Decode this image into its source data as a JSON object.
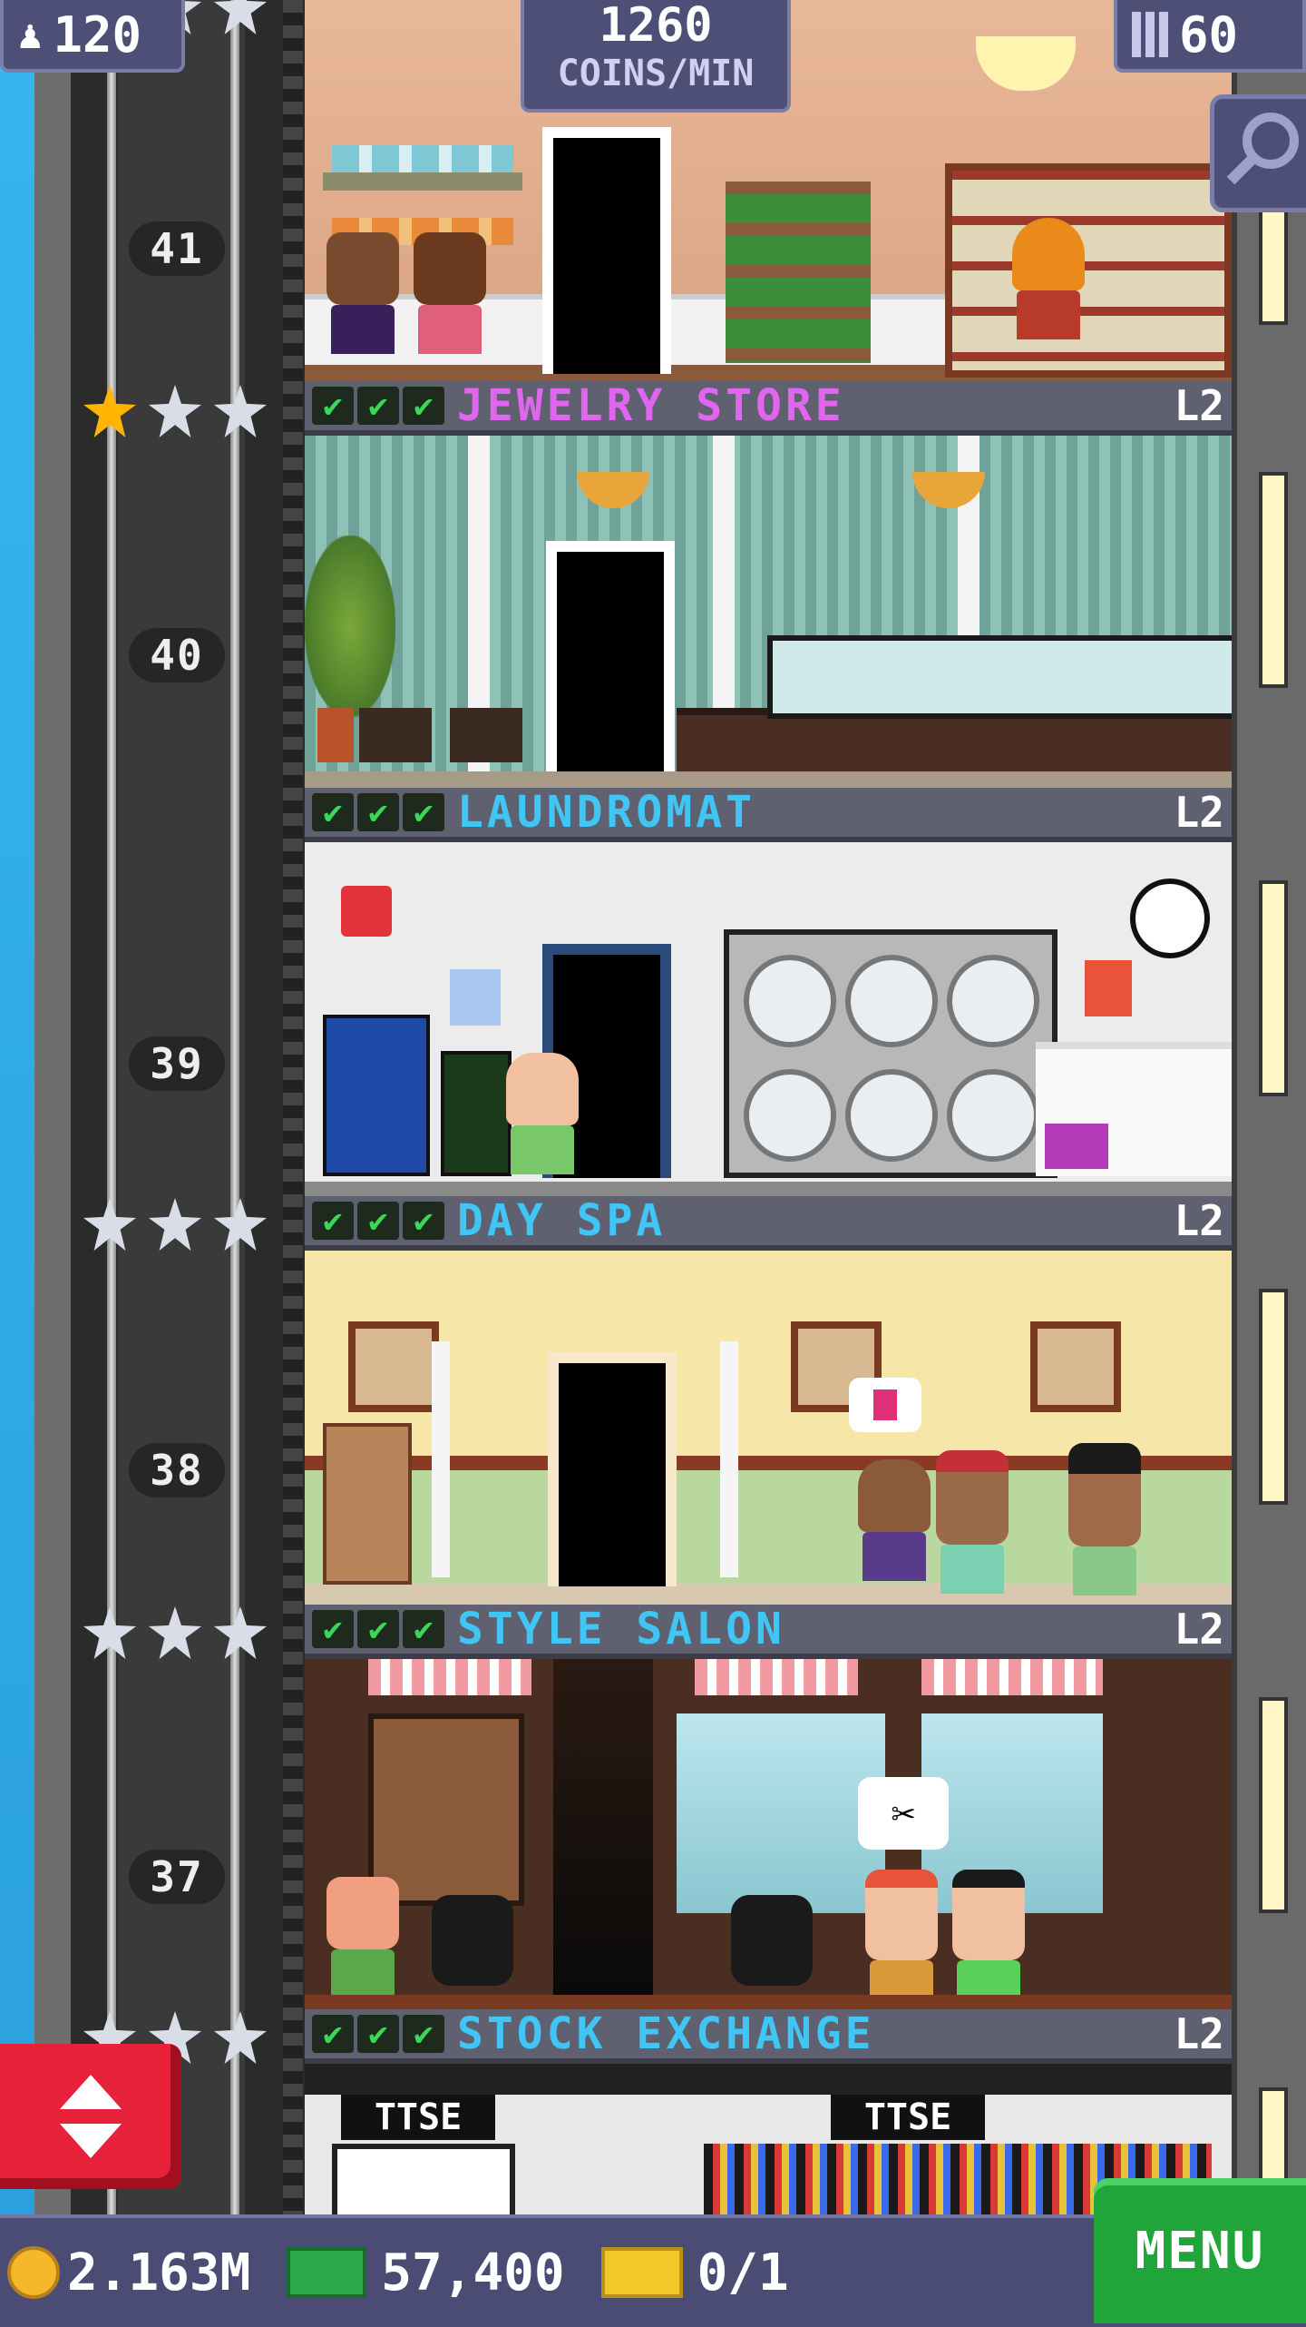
{
  "hud": {
    "population": "120",
    "coins_per_min_value": "1260",
    "coins_per_min_label": "COINS/MIN",
    "floors": "60"
  },
  "floors": [
    {
      "number": "41",
      "name": "JEWELRY STORE",
      "level": "L2",
      "name_color": "#e066f0"
    },
    {
      "number": "40",
      "name": "LAUNDROMAT",
      "level": "L2",
      "name_color": "#3fc6f5"
    },
    {
      "number": "39",
      "name": "DAY SPA",
      "level": "L2",
      "name_color": "#3fc6f5"
    },
    {
      "number": "38",
      "name": "STYLE SALON",
      "level": "L2",
      "name_color": "#3fc6f5"
    },
    {
      "number": "37",
      "name": "STOCK EXCHANGE",
      "level": "L2",
      "name_color": "#3fc6f5"
    }
  ],
  "stock_exchange": {
    "sign_left": "TTSE",
    "sign_right": "TTSE"
  },
  "status_bar": {
    "coins": "2.163M",
    "bux": "57,400",
    "tickets": "0/1",
    "menu_label": "MENU"
  },
  "icons": [
    "person-icon",
    "building-icon",
    "search-icon",
    "star-icon",
    "check-icon",
    "elevator-arrows-icon",
    "coin-icon",
    "bux-icon",
    "ticket-icon"
  ]
}
